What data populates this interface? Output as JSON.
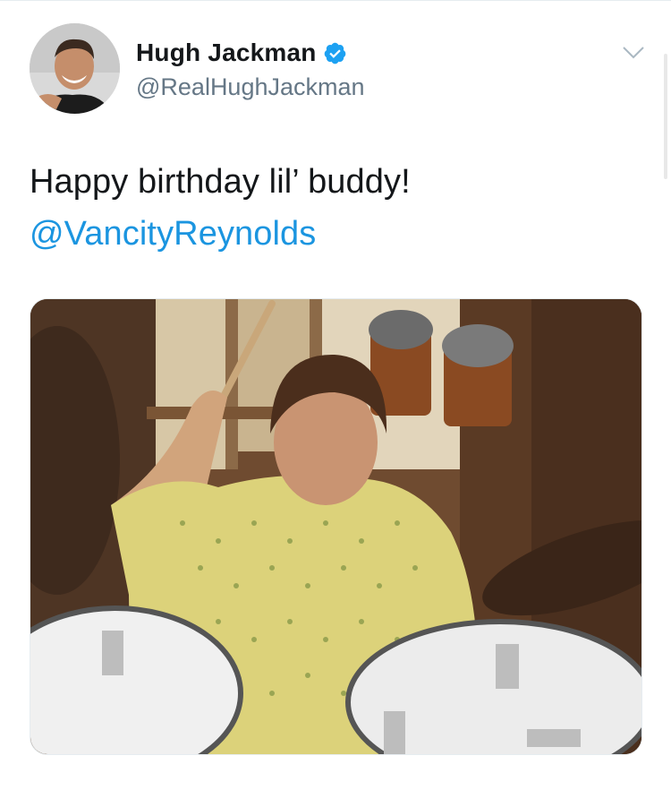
{
  "author": {
    "name": "Hugh Jackman",
    "handle": "@RealHughJackman",
    "verified_icon": "verified-badge-icon",
    "avatar_icon": "avatar-photo"
  },
  "tweet": {
    "text": "Happy birthday lil’ buddy!",
    "mention": "@VancityReynolds"
  },
  "media": {
    "type": "photo",
    "description_icon": "tweet-photo"
  },
  "controls": {
    "menu_icon": "chevron-down-icon"
  },
  "colors": {
    "text": "#14171a",
    "secondary": "#657786",
    "link": "#1b95e0",
    "verified": "#1da1f2"
  }
}
